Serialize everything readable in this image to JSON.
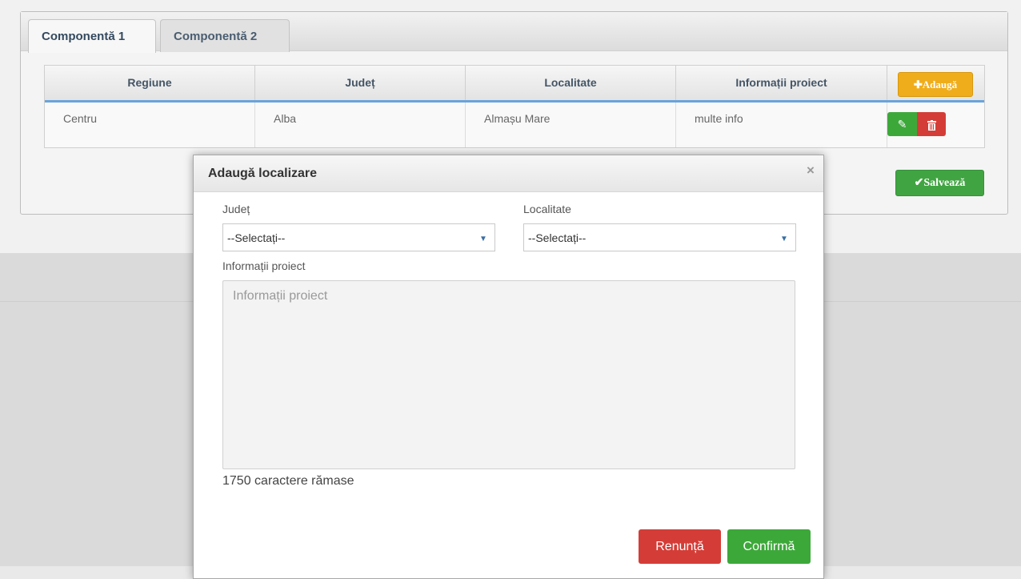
{
  "tabs": [
    {
      "label": "Componentă 1",
      "active": true
    },
    {
      "label": "Componentă 2",
      "active": false
    }
  ],
  "table": {
    "columns": [
      "Regiune",
      "Județ",
      "Localitate",
      "Informații proiect"
    ],
    "add_button_label": "Adaugă",
    "rows": [
      {
        "regiune": "Centru",
        "judet": "Alba",
        "localitate": "Almașu Mare",
        "informatii": "multe info"
      }
    ]
  },
  "save_button_label": "Salvează",
  "modal": {
    "title": "Adaugă localizare",
    "close_glyph": "×",
    "judet": {
      "label": "Județ",
      "value": "--Selectați--"
    },
    "localitate": {
      "label": "Localitate",
      "value": "--Selectați--"
    },
    "informatii": {
      "label": "Informații proiect",
      "placeholder": "Informații proiect"
    },
    "char_count": "1750 caractere rămase",
    "cancel_label": "Renunță",
    "confirm_label": "Confirmă"
  },
  "colors": {
    "accent_blue": "#6aa4dc",
    "add_yellow": "#f0ad1b",
    "success_green": "#3da83a",
    "danger_red": "#d43d37"
  },
  "icons": {
    "add": "plus-icon",
    "edit": "edit-icon",
    "delete": "trash-icon",
    "save": "check-icon",
    "close": "close-icon",
    "dropdown": "caret-down-icon"
  }
}
